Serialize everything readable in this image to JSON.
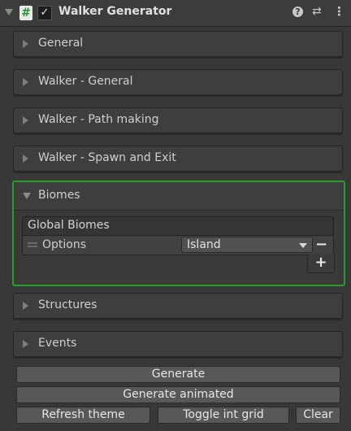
{
  "header": {
    "title": "Walker Generator",
    "script_icon_glyph": "#",
    "enabled_glyph": "✓",
    "help_glyph": "?",
    "preset_glyph": "⇄",
    "menu_glyph": "⋮"
  },
  "sections": {
    "general": "General",
    "walker_general": "Walker - General",
    "walker_path": "Walker - Path making",
    "walker_spawn": "Walker - Spawn and Exit",
    "biomes": "Biomes",
    "structures": "Structures",
    "events": "Events"
  },
  "biomes": {
    "list_title": "Global Biomes",
    "option_label": "Options",
    "option_value": "Island",
    "remove_glyph": "−",
    "add_glyph": "+"
  },
  "buttons": {
    "generate": "Generate",
    "generate_animated": "Generate animated",
    "refresh_theme": "Refresh theme",
    "toggle_int_grid": "Toggle int grid",
    "clear": "Clear"
  },
  "colors": {
    "background": "#383838",
    "highlight_border": "#2a9c2a",
    "button": "#585858"
  }
}
